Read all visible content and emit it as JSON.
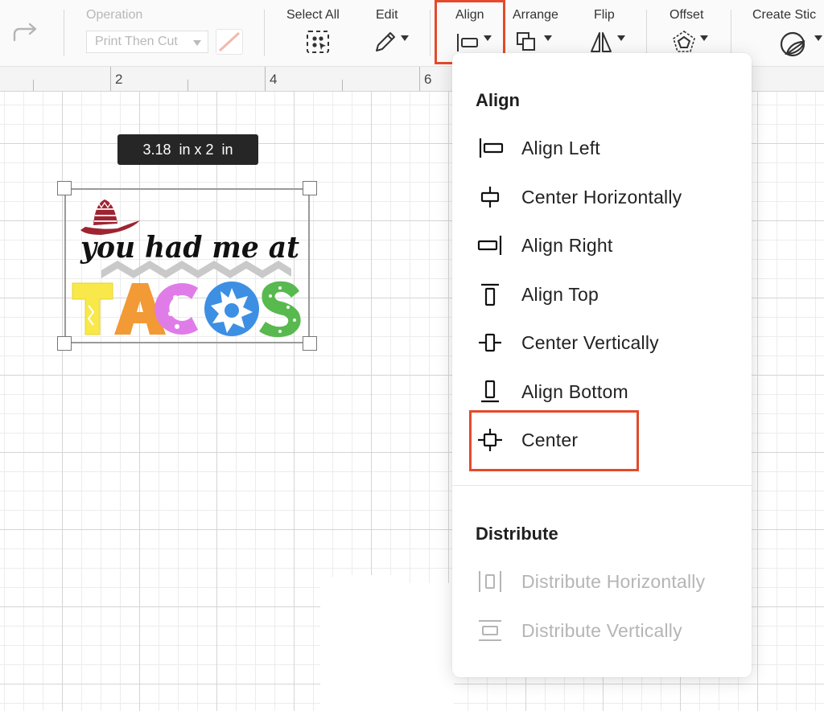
{
  "toolbar": {
    "redo_icon": "redo-arrow-icon",
    "operation_label": "Operation",
    "operation_value": "Print Then Cut",
    "select_all_label": "Select All",
    "edit_label": "Edit",
    "align_label": "Align",
    "arrange_label": "Arrange",
    "flip_label": "Flip",
    "offset_label": "Offset",
    "create_sticker_label": "Create Stic"
  },
  "ruler": {
    "marks": [
      "2",
      "4",
      "6"
    ]
  },
  "canvas": {
    "size_badge": "3.18  in x 2  in",
    "design": {
      "line1": "you had me at",
      "letters": [
        "T",
        "A",
        "C",
        "O",
        "S"
      ],
      "letter_colors": [
        "#f8e84a",
        "#f29a35",
        "#e07ce8",
        "#3d8fe3",
        "#58b94e"
      ]
    }
  },
  "align_menu": {
    "title": "Align",
    "items": [
      {
        "label": "Align Left",
        "icon": "align-left-icon"
      },
      {
        "label": "Center Horizontally",
        "icon": "center-horizontally-icon"
      },
      {
        "label": "Align Right",
        "icon": "align-right-icon"
      },
      {
        "label": "Align Top",
        "icon": "align-top-icon"
      },
      {
        "label": "Center Vertically",
        "icon": "center-vertically-icon"
      },
      {
        "label": "Align Bottom",
        "icon": "align-bottom-icon"
      },
      {
        "label": "Center",
        "icon": "center-icon"
      }
    ],
    "distribute_title": "Distribute",
    "distribute_items": [
      {
        "label": "Distribute Horizontally",
        "icon": "distribute-horizontally-icon"
      },
      {
        "label": "Distribute Vertically",
        "icon": "distribute-vertically-icon"
      }
    ]
  },
  "colors": {
    "highlight": "#e44a2b",
    "tooltip_bg": "#262626",
    "disabled_text": "#b5b5b5"
  }
}
